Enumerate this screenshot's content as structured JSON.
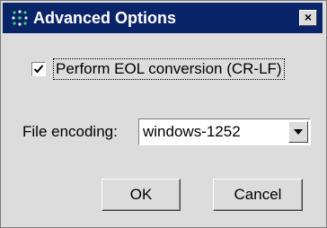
{
  "window": {
    "title": "Advanced Options",
    "close_glyph": "×",
    "icon": "app-dots-icon",
    "titlebar_color": "#0a246a"
  },
  "options": {
    "eol_checkbox_label": "Perform EOL conversion (CR-LF)",
    "eol_checked": true,
    "encoding_label": "File encoding:",
    "encoding_value": "windows-1252"
  },
  "buttons": {
    "ok_label": "OK",
    "cancel_label": "Cancel"
  }
}
